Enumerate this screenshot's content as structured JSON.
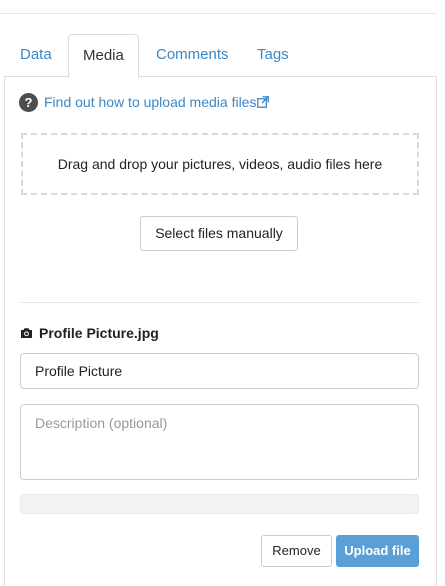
{
  "tabs": [
    {
      "label": "Data",
      "active": false
    },
    {
      "label": "Media",
      "active": true
    },
    {
      "label": "Comments",
      "active": false
    },
    {
      "label": "Tags",
      "active": false
    }
  ],
  "help": {
    "icon": "question-circle-icon",
    "link_text": "Find out how to upload media files",
    "link_icon": "external-link-icon"
  },
  "dropzone": {
    "text": "Drag and drop your pictures, videos, audio files here"
  },
  "select_button": {
    "label": "Select files manually"
  },
  "file": {
    "icon": "camera-icon",
    "name": "Profile Picture.jpg",
    "title_value": "Profile Picture",
    "description_placeholder": "Description (optional)",
    "description_value": "",
    "upload_progress": 0
  },
  "actions": {
    "remove_label": "Remove",
    "upload_label": "Upload file"
  },
  "colors": {
    "link": "#3a87c6",
    "primary": "#5aa0d6",
    "border": "#cccccc"
  }
}
